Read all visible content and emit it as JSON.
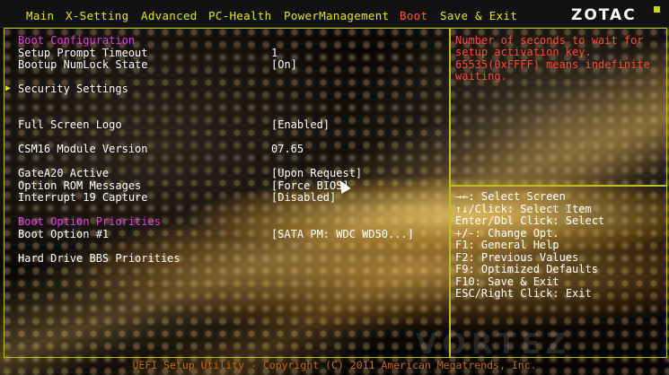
{
  "menu": {
    "items": [
      {
        "label": "Main"
      },
      {
        "label": "X-Setting"
      },
      {
        "label": "Advanced"
      },
      {
        "label": "PC-Health"
      },
      {
        "label": "PowerManagement"
      },
      {
        "label": "Boot"
      },
      {
        "label": "Save & Exit"
      }
    ],
    "active": "Boot",
    "logo": "ZOTAC"
  },
  "main": {
    "boot_config_title": "Boot Configuration",
    "setup_prompt_label": "Setup Prompt Timeout",
    "setup_prompt_value": "1",
    "numlock_label": "Bootup NumLock State",
    "numlock_value": "[On]",
    "security_label": "Security Settings",
    "full_screen_logo_label": "Full Screen Logo",
    "full_screen_logo_value": "[Enabled]",
    "csm16_label": "CSM16 Module Version",
    "csm16_value": "07.65",
    "gatea20_label": "GateA20 Active",
    "gatea20_value": "[Upon Request]",
    "option_rom_label": "Option ROM Messages",
    "option_rom_value": "[Force BIOS]",
    "interrupt19_label": "Interrupt 19 Capture",
    "interrupt19_value": "[Disabled]",
    "boot_priorities_title": "Boot Option Priorities",
    "boot_option1_label": "Boot Option #1",
    "boot_option1_value": "[SATA  PM: WDC WD50...]",
    "hdd_bbs_label": "Hard Drive BBS Priorities"
  },
  "help": {
    "text": "Number of seconds to wait for setup activation key. 65535(0xFFFF) means indefinite waiting.",
    "lines": [
      "Number of seconds to wait for",
      "setup activation key.",
      "65535(0xFFFF) means indefinite",
      "waiting."
    ]
  },
  "keys": {
    "lines": [
      "→←: Select Screen",
      "↑↓/Click: Select Item",
      "Enter/Dbl Click: Select",
      "+/-: Change Opt.",
      "F1: General Help",
      "F2: Previous Values",
      "F9: Optimized Defaults",
      "F10: Save & Exit",
      "ESC/Right Click: Exit"
    ]
  },
  "footer": "UEFI Setup Utility - Copyright (C) 2011 American Megatrends, Inc.",
  "watermark": "VORTEZ",
  "colors": {
    "menu_text": "#e6e600",
    "menu_active": "#ff5b2e",
    "section_title": "#e23de0",
    "help_text": "#ff4a36",
    "frame": "#b8c022",
    "footer": "#c76a10"
  }
}
